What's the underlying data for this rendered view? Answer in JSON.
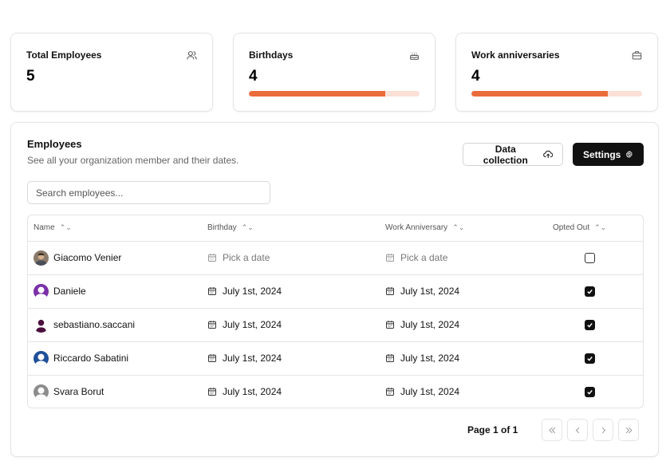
{
  "stats": [
    {
      "title": "Total Employees",
      "value": "5",
      "icon": "users-icon"
    },
    {
      "title": "Birthdays",
      "value": "4",
      "icon": "cake-icon",
      "progress": 0.8
    },
    {
      "title": "Work anniversaries",
      "value": "4",
      "icon": "briefcase-icon",
      "progress": 0.8
    }
  ],
  "employees": {
    "title": "Employees",
    "description": "See all your organization member and their dates.",
    "data_collection_label": "Data collection",
    "settings_label": "Settings",
    "search_placeholder": "Search employees..."
  },
  "table": {
    "headers": [
      "Name",
      "Birthday",
      "Work Anniversary",
      "Opted Out"
    ],
    "rows": [
      {
        "name": "Giacomo Venier",
        "birthday": "Pick a date",
        "anniversary": "Pick a date",
        "opted_out": false,
        "avatar": "photo"
      },
      {
        "name": "Daniele",
        "birthday": "July 1st, 2024",
        "anniversary": "July 1st, 2024",
        "opted_out": true,
        "avatar": "purple"
      },
      {
        "name": "sebastiano.saccani",
        "birthday": "July 1st, 2024",
        "anniversary": "July 1st, 2024",
        "opted_out": true,
        "avatar": "plum"
      },
      {
        "name": "Riccardo Sabatini",
        "birthday": "July 1st, 2024",
        "anniversary": "July 1st, 2024",
        "opted_out": true,
        "avatar": "blue"
      },
      {
        "name": "Svara Borut",
        "birthday": "July 1st, 2024",
        "anniversary": "July 1st, 2024",
        "opted_out": true,
        "avatar": "gray"
      }
    ]
  },
  "pagination": {
    "label": "Page 1 of 1"
  },
  "colors": {
    "accent": "#ea6c3b",
    "accent_track": "#fbe0d6",
    "dark": "#111111"
  }
}
